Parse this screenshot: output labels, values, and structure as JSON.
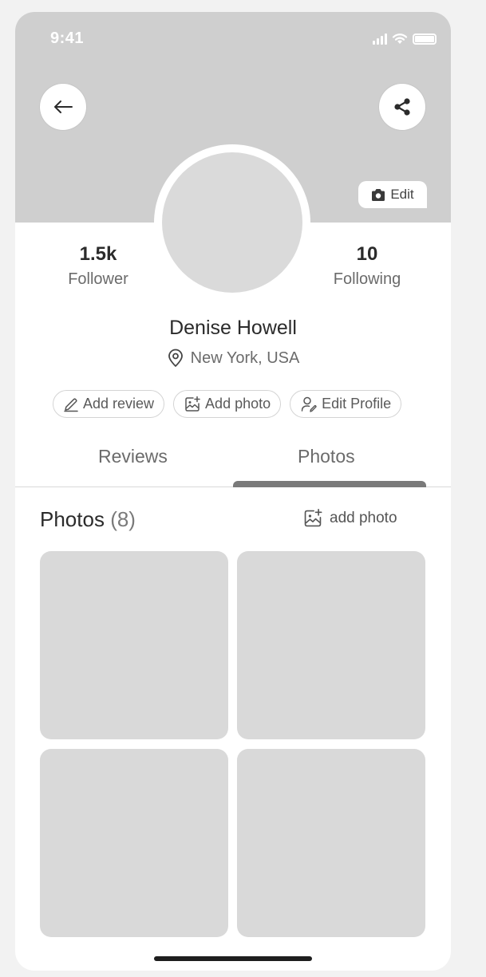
{
  "status_bar": {
    "time": "9:41"
  },
  "header": {
    "back_icon": "arrow-left-icon",
    "share_icon": "share-icon",
    "edit_cover_label": "Edit",
    "edit_cover_icon": "camera-icon"
  },
  "profile": {
    "followers_count": "1.5k",
    "followers_label": "Follower",
    "following_count": "10",
    "following_label": "Following",
    "name": "Denise Howell",
    "location": "New York, USA"
  },
  "actions": [
    {
      "label": "Add review",
      "icon": "pencil-icon"
    },
    {
      "label": "Add photo",
      "icon": "image-add-icon"
    },
    {
      "label": "Edit Profile",
      "icon": "user-edit-icon"
    }
  ],
  "tabs": [
    {
      "label": "Reviews",
      "active": false
    },
    {
      "label": "Photos",
      "active": true
    }
  ],
  "photos_section": {
    "title": "Photos",
    "count": "(8)",
    "add_photo_label": "add photo"
  },
  "colors": {
    "cover": "#cfcfcf",
    "placeholder": "#d9d9d9",
    "tab_indicator": "#7a7a7a"
  }
}
